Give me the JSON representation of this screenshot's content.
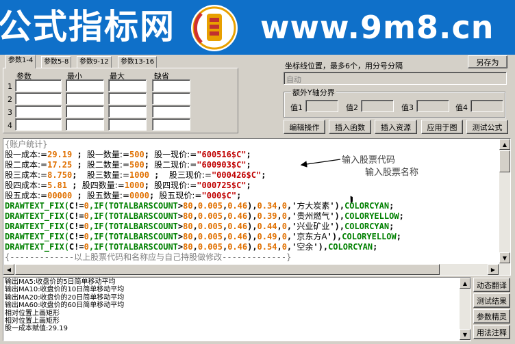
{
  "banner": {
    "left_title": "公式指标网",
    "url": "www.9m8.cn",
    "logo_text": "www.9m8.cn"
  },
  "tabs": [
    {
      "label": "参数1-4",
      "active": true
    },
    {
      "label": "参数5-8",
      "active": false
    },
    {
      "label": "参数9-12",
      "active": false
    },
    {
      "label": "参数13-16",
      "active": false
    }
  ],
  "params": {
    "headers": [
      "参数",
      "最小",
      "最大",
      "缺省"
    ],
    "rows": [
      "1",
      "2",
      "3",
      "4"
    ]
  },
  "coord": {
    "label": "坐标线位置，最多6个，用分号分隔",
    "value": "自动",
    "save_as": "另存为"
  },
  "extra_axis": {
    "legend": "额外Y轴分界",
    "labels": [
      "值1",
      "值2",
      "值3",
      "值4"
    ]
  },
  "buttons": {
    "edit": "编辑操作",
    "insert_func": "插入函数",
    "insert_res": "插入资源",
    "apply_chart": "应用于图",
    "test": "测试公式"
  },
  "side_buttons": [
    "动态翻译",
    "测试结果",
    "参数精灵",
    "用法注释"
  ],
  "annotations": {
    "code": "输入股票代码",
    "name": "输入股票名称"
  },
  "editor_lines": [
    [
      [
        "{账户统计}",
        "t-gray"
      ]
    ],
    [
      [
        "股一成本:=",
        "t-chs"
      ],
      [
        "29.19",
        "t-num"
      ],
      [
        " ; ",
        "t-op"
      ],
      [
        "股一数量:=",
        "t-chs"
      ],
      [
        "500",
        "t-num"
      ],
      [
        "; ",
        "t-op"
      ],
      [
        "股一现价:=",
        "t-chs"
      ],
      [
        "\"600516$C\"",
        "t-str"
      ],
      [
        ";",
        "t-op"
      ]
    ],
    [
      [
        "股二成本:=",
        "t-chs"
      ],
      [
        "17.25",
        "t-num"
      ],
      [
        " ; ",
        "t-op"
      ],
      [
        "股二数量:=",
        "t-chs"
      ],
      [
        "500",
        "t-num"
      ],
      [
        "; ",
        "t-op"
      ],
      [
        "股二现价:=",
        "t-chs"
      ],
      [
        "\"600903$C\"",
        "t-str"
      ],
      [
        ";",
        "t-op"
      ]
    ],
    [
      [
        "股三成本:=",
        "t-chs"
      ],
      [
        "8.750",
        "t-num"
      ],
      [
        ";  ",
        "t-op"
      ],
      [
        "股三数量:=",
        "t-chs"
      ],
      [
        "1000",
        "t-num"
      ],
      [
        " ;  ",
        "t-op"
      ],
      [
        "股三现价:=",
        "t-chs"
      ],
      [
        "\"000426$C\"",
        "t-str"
      ],
      [
        ";",
        "t-op"
      ]
    ],
    [
      [
        "股四成本:=",
        "t-chs"
      ],
      [
        "5.81",
        "t-num"
      ],
      [
        " ; ",
        "t-op"
      ],
      [
        "股四数量:=",
        "t-chs"
      ],
      [
        "1000",
        "t-num"
      ],
      [
        "; ",
        "t-op"
      ],
      [
        "股四现价:=",
        "t-chs"
      ],
      [
        "\"000725$C\"",
        "t-str"
      ],
      [
        ";",
        "t-op"
      ]
    ],
    [
      [
        "股五成本:=",
        "t-chs"
      ],
      [
        "00000",
        "t-num"
      ],
      [
        " ; ",
        "t-op"
      ],
      [
        "股五数量:=",
        "t-chs"
      ],
      [
        "0000",
        "t-num"
      ],
      [
        "; ",
        "t-op"
      ],
      [
        "股五现价:=",
        "t-chs"
      ],
      [
        "\"000$C\"",
        "t-str"
      ],
      [
        ";",
        "t-op"
      ]
    ],
    [
      [
        "DRAWTEXT_FIX(",
        "t-fn"
      ],
      [
        "C!=",
        "t-black"
      ],
      [
        "0",
        "t-num"
      ],
      [
        ",IF(",
        "t-fn"
      ],
      [
        "TOTALBARSCOUNT",
        "t-fn"
      ],
      [
        ">",
        "t-op"
      ],
      [
        "80",
        "t-num"
      ],
      [
        ",",
        "t-op"
      ],
      [
        "0.005",
        "t-num"
      ],
      [
        ",",
        "t-op"
      ],
      [
        "0.46",
        "t-num"
      ],
      [
        "),",
        "t-op"
      ],
      [
        "0.34",
        "t-num"
      ],
      [
        ",",
        "t-op"
      ],
      [
        "0",
        "t-num"
      ],
      [
        ",'",
        "t-op"
      ],
      [
        "方大炭素",
        "t-chs"
      ],
      [
        "'),",
        "t-op"
      ],
      [
        "COLORCYAN",
        "t-fn"
      ],
      [
        ";",
        "t-op"
      ]
    ],
    [
      [
        "DRAWTEXT_FIX(",
        "t-fn"
      ],
      [
        "C!=",
        "t-black"
      ],
      [
        "0",
        "t-num"
      ],
      [
        ",IF(",
        "t-fn"
      ],
      [
        "TOTALBARSCOUNT",
        "t-fn"
      ],
      [
        ">",
        "t-op"
      ],
      [
        "80",
        "t-num"
      ],
      [
        ",",
        "t-op"
      ],
      [
        "0.005",
        "t-num"
      ],
      [
        ",",
        "t-op"
      ],
      [
        "0.46",
        "t-num"
      ],
      [
        "),",
        "t-op"
      ],
      [
        "0.39",
        "t-num"
      ],
      [
        ",",
        "t-op"
      ],
      [
        "0",
        "t-num"
      ],
      [
        ",'",
        "t-op"
      ],
      [
        "贵州燃气",
        "t-chs"
      ],
      [
        "'),",
        "t-op"
      ],
      [
        "COLORYELLOW",
        "t-fn"
      ],
      [
        ";",
        "t-op"
      ]
    ],
    [
      [
        "DRAWTEXT_FIX(",
        "t-fn"
      ],
      [
        "C!=",
        "t-black"
      ],
      [
        "0",
        "t-num"
      ],
      [
        ",IF(",
        "t-fn"
      ],
      [
        "TOTALBARSCOUNT",
        "t-fn"
      ],
      [
        ">",
        "t-op"
      ],
      [
        "80",
        "t-num"
      ],
      [
        ",",
        "t-op"
      ],
      [
        "0.005",
        "t-num"
      ],
      [
        ",",
        "t-op"
      ],
      [
        "0.46",
        "t-num"
      ],
      [
        "),",
        "t-op"
      ],
      [
        "0.44",
        "t-num"
      ],
      [
        ",",
        "t-op"
      ],
      [
        "0",
        "t-num"
      ],
      [
        ",'",
        "t-op"
      ],
      [
        "兴业矿业",
        "t-chs"
      ],
      [
        "'),",
        "t-op"
      ],
      [
        "COLORCYAN",
        "t-fn"
      ],
      [
        ";",
        "t-op"
      ]
    ],
    [
      [
        "DRAWTEXT_FIX(",
        "t-fn"
      ],
      [
        "C!=",
        "t-black"
      ],
      [
        "0",
        "t-num"
      ],
      [
        ",IF(",
        "t-fn"
      ],
      [
        "TOTALBARSCOUNT",
        "t-fn"
      ],
      [
        ">",
        "t-op"
      ],
      [
        "80",
        "t-num"
      ],
      [
        ",",
        "t-op"
      ],
      [
        "0.005",
        "t-num"
      ],
      [
        ",",
        "t-op"
      ],
      [
        "0.46",
        "t-num"
      ],
      [
        "),",
        "t-op"
      ],
      [
        "0.49",
        "t-num"
      ],
      [
        ",",
        "t-op"
      ],
      [
        "0",
        "t-num"
      ],
      [
        ",'",
        "t-op"
      ],
      [
        "京东方A",
        "t-chs"
      ],
      [
        "'),",
        "t-op"
      ],
      [
        "COLORYELLOW",
        "t-fn"
      ],
      [
        ";",
        "t-op"
      ]
    ],
    [
      [
        "DRAWTEXT_FIX(",
        "t-fn"
      ],
      [
        "C!=",
        "t-black"
      ],
      [
        "0",
        "t-num"
      ],
      [
        ",IF(",
        "t-fn"
      ],
      [
        "TOTALBARSCOUNT",
        "t-fn"
      ],
      [
        ">",
        "t-op"
      ],
      [
        "80",
        "t-num"
      ],
      [
        ",",
        "t-op"
      ],
      [
        "0.005",
        "t-num"
      ],
      [
        ",",
        "t-op"
      ],
      [
        "0.46",
        "t-num"
      ],
      [
        "),",
        "t-op"
      ],
      [
        "0.54",
        "t-num"
      ],
      [
        ",",
        "t-op"
      ],
      [
        "0",
        "t-num"
      ],
      [
        ",'",
        "t-op"
      ],
      [
        "空余",
        "t-chs"
      ],
      [
        "'),",
        "t-op"
      ],
      [
        "COLORCYAN",
        "t-fn"
      ],
      [
        ";",
        "t-op"
      ]
    ],
    [
      [
        "{-------------以上股票代码和名称应与自己持股做修改-------------}",
        "t-gray"
      ]
    ]
  ],
  "output_lines": [
    "输出MA5:收盘价的5日简单移动平均",
    "输出MA10:收盘价的10日简单移动平均",
    "输出MA20:收盘价的20日简单移动平均",
    "输出MA60:收盘价的60日简单移动平均",
    "相对位置上画矩形",
    "相对位置上画矩形",
    "股一成本赋值:29.19"
  ],
  "colors": {
    "banner": "#0f70c9",
    "dialog": "#d4d0c8",
    "string": "#c00000",
    "number": "#e07000",
    "function": "#008000"
  }
}
